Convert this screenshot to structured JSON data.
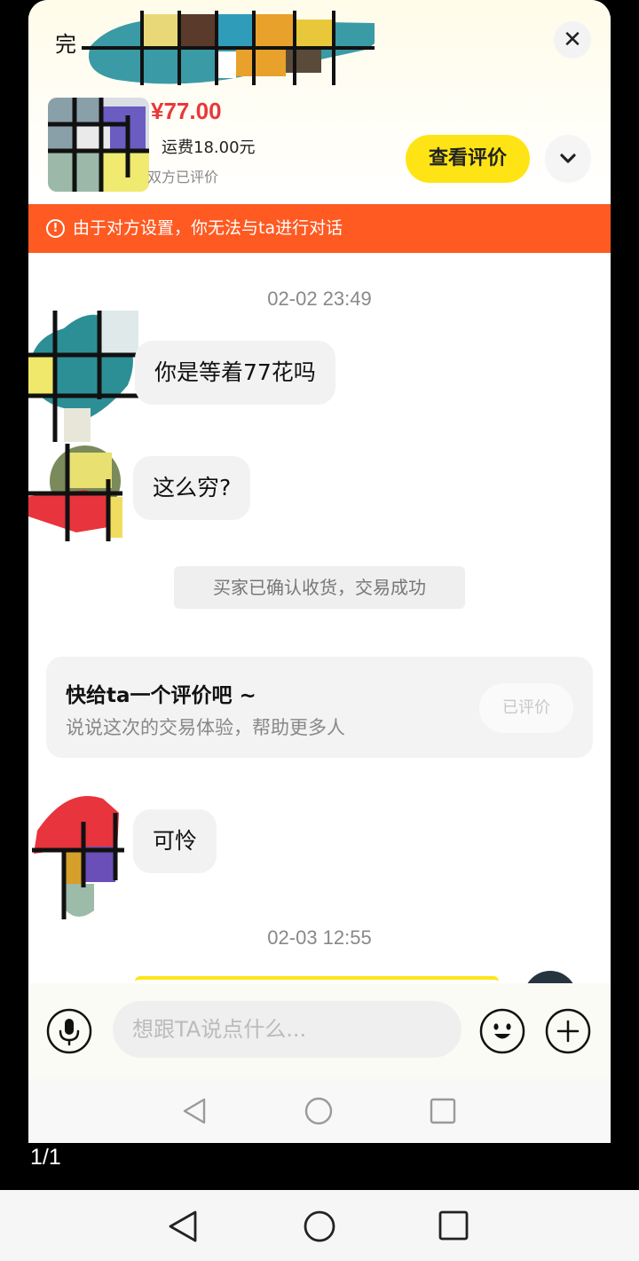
{
  "header": {
    "title_fragment": "完",
    "price": "¥77.00",
    "shipping": "运费18.00元",
    "rated_status": "双方已评价",
    "view_review_label": "查看评价",
    "close_glyph": "✕"
  },
  "notice": {
    "text": "由于对方设置，你无法与ta进行对话",
    "icon": "!"
  },
  "messages": {
    "time_1": "02-02 23:49",
    "msg_1": "你是等着77花吗",
    "msg_2": "这么穷?",
    "system": "买家已确认收货，交易成功",
    "time_2": "02-03 12:55",
    "msg_3": "可怜"
  },
  "review_card": {
    "title": "快给ta一个评价吧 ~",
    "subtitle": "说说这次的交易体验，帮助更多人",
    "button": "已评价"
  },
  "input": {
    "placeholder": "想跟TA说点什么..."
  },
  "viewer": {
    "page_counter": "1/1"
  },
  "colors": {
    "accent_yellow": "#ffe415",
    "notice_orange": "#fe5a22",
    "price_red": "#e8383b"
  },
  "icons": [
    "close-icon",
    "chevron-down-icon",
    "alert-circle-icon",
    "microphone-icon",
    "emoji-icon",
    "plus-icon",
    "back-icon",
    "home-icon",
    "recents-icon"
  ]
}
